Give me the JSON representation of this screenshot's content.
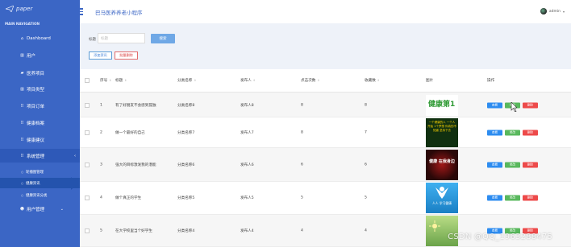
{
  "logo": {
    "text": "paper"
  },
  "nav": {
    "heading": "MAIN NAVIGATION",
    "items": [
      {
        "label": "Dashboard",
        "icon": "home-icon"
      },
      {
        "label": "用户",
        "icon": "bar-chart-icon"
      },
      {
        "label": "医养项目",
        "icon": "comment-icon"
      },
      {
        "label": "项目类型",
        "icon": "bar-chart-icon"
      },
      {
        "label": "项目订单",
        "icon": "grid-icon"
      },
      {
        "label": "健康档案",
        "icon": "grid-icon"
      },
      {
        "label": "健康建议",
        "icon": "grid-icon"
      },
      {
        "label": "系统管理",
        "icon": "grid-icon",
        "expanded_icon": "chevron-left-icon"
      },
      {
        "label": "用户管理",
        "icon": "user-icon",
        "expand_icon": "chevron-down-icon"
      }
    ],
    "sub_items": [
      {
        "label": "轮播图管理"
      },
      {
        "label": "健康资讯",
        "selected": true
      },
      {
        "label": "健康资讯分类"
      }
    ]
  },
  "header": {
    "title": "巴马医养养老小程序",
    "user": "admin"
  },
  "filter": {
    "label": "标题",
    "placeholder": "标题",
    "search_button": "搜索",
    "add_button": "添加资讯",
    "delete_button": "批量删除"
  },
  "table": {
    "headers": [
      "序号",
      "标题",
      "分类名称",
      "发布人",
      "点击次数",
      "收藏数",
      "图片",
      "操作"
    ],
    "rows": [
      {
        "index": "1",
        "title": "有了好朋友不会感到孤独",
        "category": "分类名称8",
        "publisher": "发布人8",
        "clicks": "8",
        "favorites": "8"
      },
      {
        "index": "2",
        "title": "做一个最好的自己",
        "category": "分类名称7",
        "publisher": "发布人7",
        "clicks": "8",
        "favorites": "7"
      },
      {
        "index": "3",
        "title": "强大的目标激发我的潜能",
        "category": "分类名称6",
        "publisher": "发布人6",
        "clicks": "6",
        "favorites": "6"
      },
      {
        "index": "4",
        "title": "做个真正的学生",
        "category": "分类名称5",
        "publisher": "发布人5",
        "clicks": "5",
        "favorites": "5"
      },
      {
        "index": "5",
        "title": "在大学校里当个好学生",
        "category": "分类名称4",
        "publisher": "发布人4",
        "clicks": "4",
        "favorites": "4"
      }
    ],
    "op_labels": {
      "view": "查看",
      "edit": "修改",
      "remove": "删除"
    }
  },
  "thumbnails": [
    {
      "caption": "健康第1",
      "bg": "#ffffff"
    },
    {
      "caption": "一个健康的人 一个人开始 1个梦想 你真的不知道 坚持下去",
      "bg": "#103010"
    },
    {
      "caption": "健康 在我身边",
      "bg": "#2a0808"
    },
    {
      "caption": "人人 学习健康",
      "bg": "#1a8fd4"
    },
    {
      "caption": "",
      "bg": "#8bbf66"
    }
  ],
  "watermark": "CSDN @QQ_1963288475",
  "colors": {
    "sidebar": "#3b66c5",
    "accent": "#3b66c5",
    "view": "#2d8cf0",
    "edit": "#59b85d",
    "remove": "#ed4a4a"
  }
}
